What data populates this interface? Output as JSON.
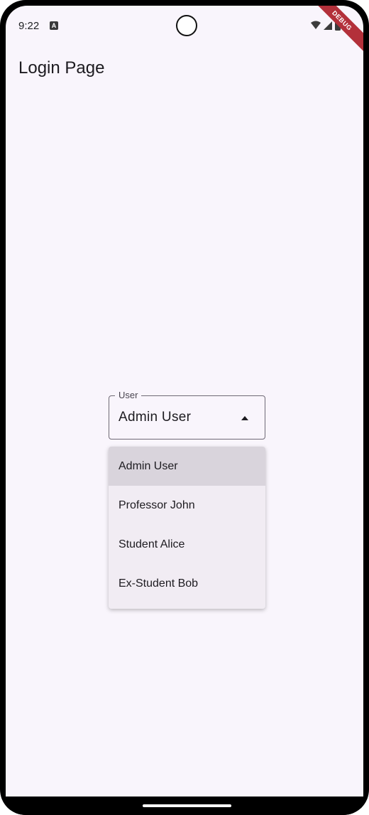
{
  "status_bar": {
    "time": "9:22",
    "notification_icon": "A",
    "debug_banner": "DEBUG"
  },
  "app_bar": {
    "title": "Login Page"
  },
  "user_dropdown": {
    "label": "User",
    "selected_value": "Admin User",
    "options": [
      "Admin User",
      "Professor John",
      "Student Alice",
      "Ex-Student Bob"
    ]
  },
  "colors": {
    "background": "#f9f5fc",
    "menu_background": "#f1ecf3",
    "selected_item": "#d9d4dc",
    "debug_banner": "#b3303a"
  }
}
